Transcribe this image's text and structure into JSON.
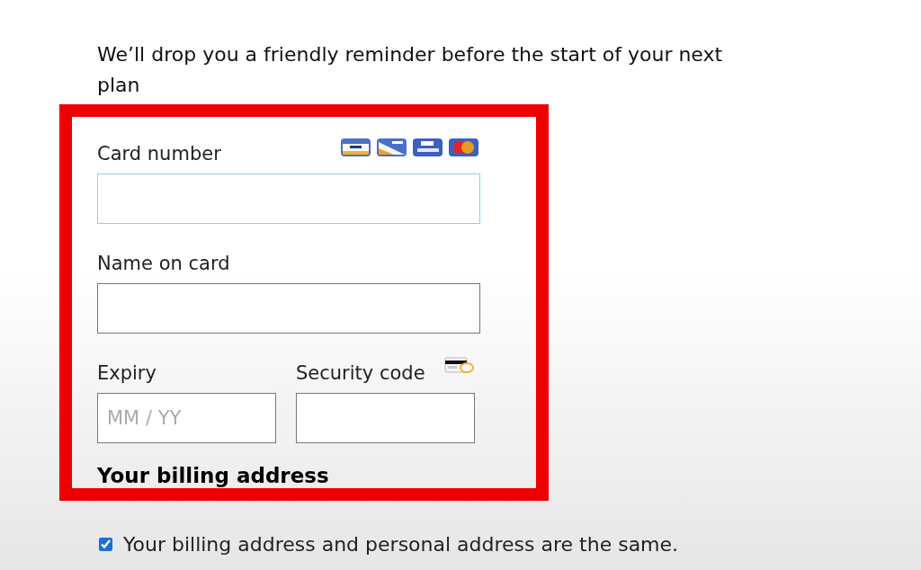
{
  "intro": "We’ll drop you a friendly reminder before the start of your next plan",
  "card_form": {
    "rows": [
      [
        {
          "label": "Card number",
          "kind": "card",
          "focused": true
        }
      ],
      [
        {
          "label": "Name on card",
          "kind": "plain",
          "focused": false
        }
      ],
      [
        {
          "label": "Expiry",
          "kind": "plain",
          "focused": false,
          "placeholder": "MM / YY"
        },
        {
          "label": "Security code",
          "kind": "cvc",
          "focused": false
        }
      ]
    ],
    "billing_heading": "Your billing address"
  },
  "same_address": {
    "label": "Your billing address and personal address are the same.",
    "checked": true
  }
}
